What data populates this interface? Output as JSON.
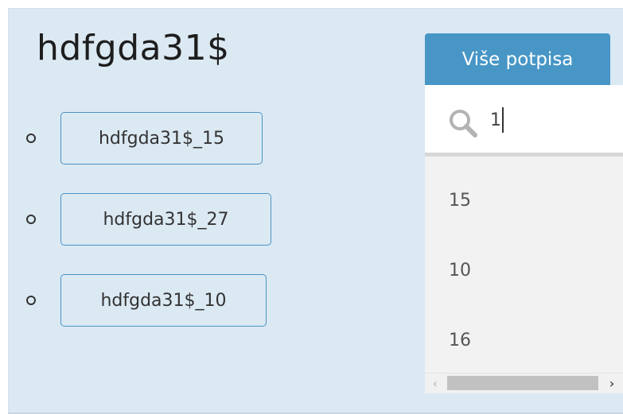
{
  "panel": {
    "title": "hdfgda31$"
  },
  "signatures": [
    {
      "label": "hdfgda31$_15"
    },
    {
      "label": "hdfgda31$_27"
    },
    {
      "label": "hdfgda31$_10"
    }
  ],
  "more_button": {
    "label": "Više potpisa"
  },
  "search": {
    "value": "1",
    "icon": "search-icon"
  },
  "options": [
    "15",
    "10",
    "16"
  ],
  "scrollbar": {
    "left_arrow": "‹",
    "right_arrow": "›"
  },
  "colors": {
    "panel_bg": "#dbe9f3",
    "accent": "#4796c6",
    "chip_border": "#4b93c4"
  }
}
